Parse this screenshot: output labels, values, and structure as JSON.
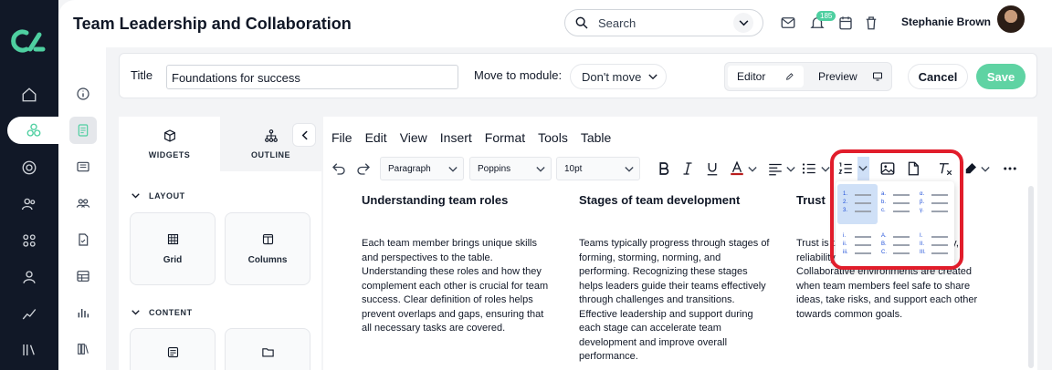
{
  "header": {
    "page_title": "Team Leadership and Collaboration",
    "search_placeholder": "Search",
    "notification_count": "185",
    "user_name": "Stephanie Brown"
  },
  "titlebar": {
    "title_label": "Title",
    "title_value": "Foundations for success",
    "move_label": "Move to module:",
    "move_value": "Don't move",
    "editor_label": "Editor",
    "preview_label": "Preview",
    "cancel_label": "Cancel",
    "save_label": "Save"
  },
  "panel": {
    "tab_widgets": "WIDGETS",
    "tab_outline": "OUTLINE",
    "layout_heading": "LAYOUT",
    "content_heading": "CONTENT",
    "layout_items": [
      "Grid",
      "Columns"
    ]
  },
  "editor": {
    "menu": [
      "File",
      "Edit",
      "View",
      "Insert",
      "Format",
      "Tools",
      "Table"
    ],
    "block_format": "Paragraph",
    "font_family": "Poppins",
    "font_size": "10pt",
    "list_styles": [
      [
        "1.",
        "2.",
        "3."
      ],
      [
        "a.",
        "b.",
        "c."
      ],
      [
        "α.",
        "β.",
        "γ."
      ],
      [
        "i.",
        "ii.",
        "iii."
      ],
      [
        "A.",
        "B.",
        "C."
      ],
      [
        "I.",
        "II.",
        "III."
      ]
    ],
    "columns": [
      {
        "heading": "Understanding team roles",
        "body": "Each team member brings unique skills and perspectives to the table. Understanding these roles and how they complement each other is crucial for team success. Clear definition of roles helps prevent overlaps and gaps, ensuring that all necessary tasks are covered."
      },
      {
        "heading": "Stages of team development",
        "body": "Teams typically progress through stages of forming, storming, norming, and performing. Recognizing these stages helps leaders guide their teams effectively through challenges and transitions. Effective leadership and support during each stage can accelerate team development and improve overall performance."
      },
      {
        "heading": "Trust",
        "body": "Trust is t... success. ... transparency, reliability, and open communication. Collaborative environments are created when team members feel safe to share ideas, take risks, and support each other towards common goals."
      }
    ]
  },
  "colors": {
    "accent": "#5fd3a3",
    "nav_bg": "#111827",
    "highlight": "#e11d2b"
  }
}
